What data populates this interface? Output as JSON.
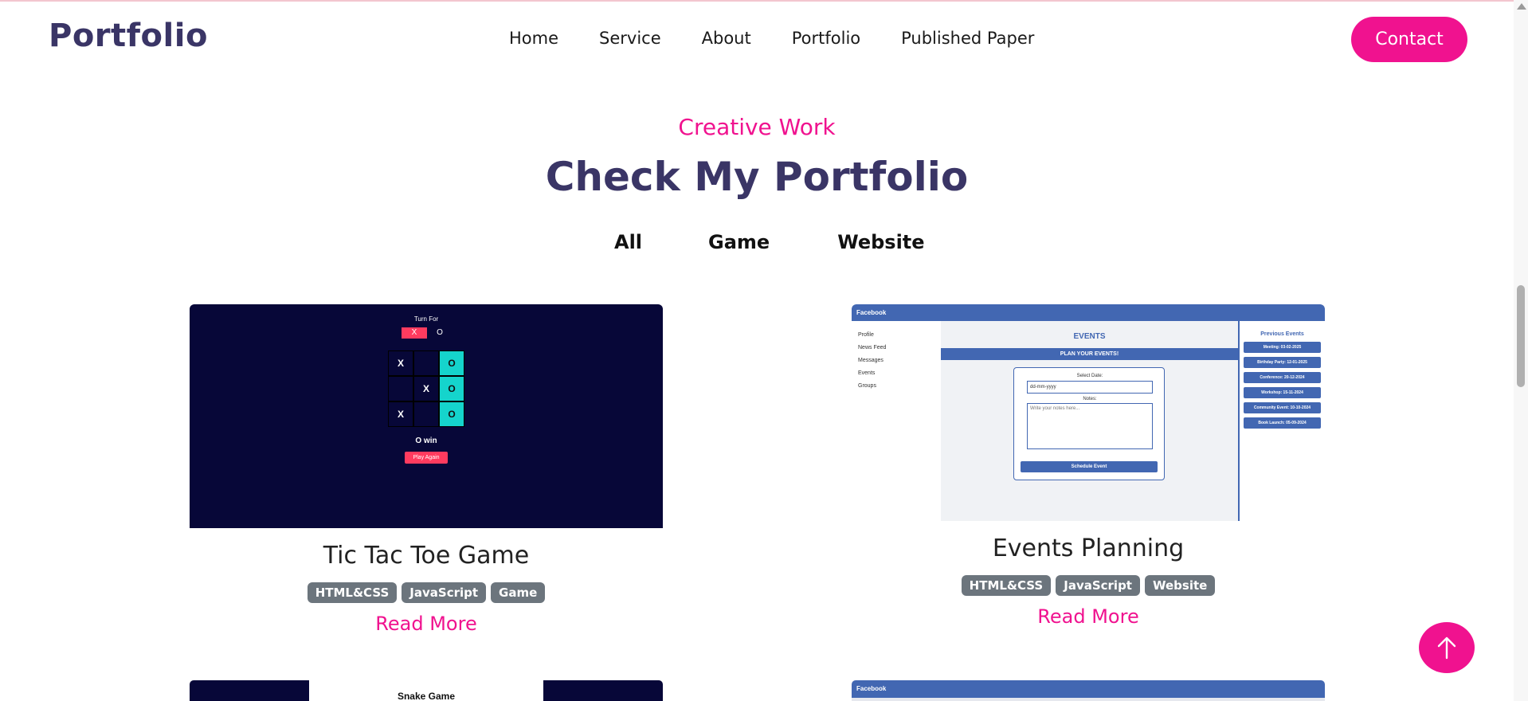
{
  "header": {
    "logo": "Portfolio",
    "nav": [
      "Home",
      "Service",
      "About",
      "Portfolio",
      "Published Paper"
    ],
    "contact_label": "Contact"
  },
  "section": {
    "subtitle": "Creative Work",
    "title": "Check My Portfolio",
    "filters": [
      "All",
      "Game",
      "Website"
    ]
  },
  "projects": [
    {
      "title": "Tic Tac Toe Game",
      "tags": [
        "HTML&CSS",
        "JavaScript",
        "Game"
      ],
      "read_more": "Read More",
      "preview": {
        "turn_label": "Turn For",
        "player_x": "X",
        "player_o": "O",
        "board": [
          "X",
          "",
          "O",
          "",
          "X",
          "O",
          "X",
          "",
          "O"
        ],
        "result": "O win",
        "play_again": "Play Again"
      }
    },
    {
      "title": "Events Planning",
      "tags": [
        "HTML&CSS",
        "JavaScript",
        "Website"
      ],
      "read_more": "Read More",
      "preview": {
        "brand": "Facebook",
        "sidebar": [
          "Profile",
          "News Feed",
          "Messages",
          "Events",
          "Groups"
        ],
        "events_title": "EVENTS",
        "plan_banner": "PLAN YOUR EVENTS!",
        "select_date_label": "Select Date:",
        "date_placeholder": "dd-mm-yyyy",
        "notes_label": "Notes:",
        "notes_placeholder": "Write your notes here...",
        "schedule_button": "Schedule Event",
        "previous_title": "Previous Events",
        "previous_events": [
          "Meeting: 03-02-2025",
          "Birthday Party: 12-01-2025",
          "Conference: 20-12-2024",
          "Workshop: 15-11-2024",
          "Community Event: 10-10-2024",
          "Book Launch: 05-09-2024"
        ]
      }
    },
    {
      "preview": {
        "title": "Snake Game"
      }
    },
    {
      "preview": {
        "brand": "Facebook"
      }
    }
  ],
  "colors": {
    "accent": "#f0128f",
    "heading": "#3a3566",
    "tag": "#6c757d",
    "game_bg": "#070738",
    "facebook_blue": "#4267b2",
    "win_cell": "#15d4cc"
  },
  "icons": {
    "scroll_top": "arrow-up-icon"
  }
}
